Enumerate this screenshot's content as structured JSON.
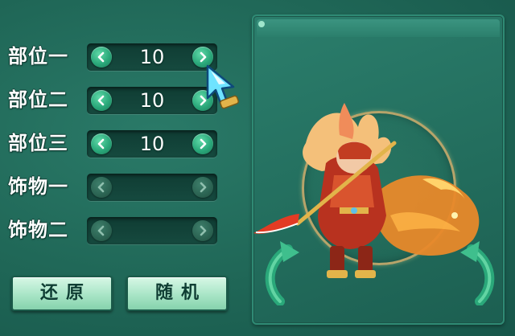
{
  "rows": [
    {
      "label": "部位一",
      "value": "10",
      "enabled": true
    },
    {
      "label": "部位二",
      "value": "10",
      "enabled": true
    },
    {
      "label": "部位三",
      "value": "10",
      "enabled": true
    },
    {
      "label": "饰物一",
      "value": "",
      "enabled": false
    },
    {
      "label": "饰物二",
      "value": "",
      "enabled": false
    }
  ],
  "buttons": {
    "restore": "还原",
    "random": "随机"
  },
  "icons": {
    "prev": "chevron-left-icon",
    "next": "chevron-right-icon",
    "rotate_left": "rotate-left-icon",
    "rotate_right": "rotate-right-icon",
    "cursor": "game-cursor-icon"
  },
  "colors": {
    "background": "#1f6656",
    "accent": "#2aa87a",
    "button_face": "#a8e5c6"
  }
}
